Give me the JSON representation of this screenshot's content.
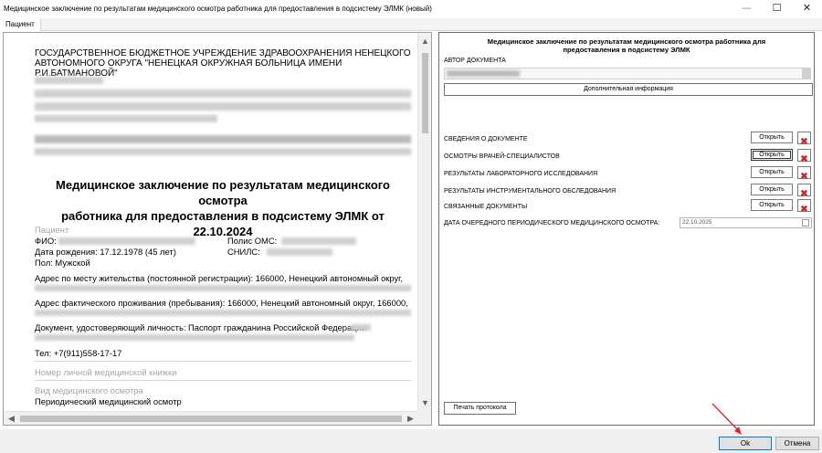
{
  "window": {
    "title": "Медицинское заключение по результатам медицинского осмотра работника для предоставления в подсистему ЭЛМК (новый)",
    "minimize_icon": "—",
    "maximize_icon": "☐",
    "close_icon": "✕"
  },
  "tab": {
    "label": "Пациент"
  },
  "document": {
    "org_line1": "ГОСУДАРСТВЕННОЕ БЮДЖЕТНОЕ УЧРЕЖДЕНИЕ ЗДРАВООХРАНЕНИЯ НЕНЕЦКОГО",
    "org_line2": "АВТОНОМНОГО ОКРУГА \"НЕНЕЦКАЯ ОКРУЖНАЯ БОЛЬНИЦА ИМЕНИ Р.И.БАТМАНОВОЙ\"",
    "title_line1": "Медицинское заключение по результатам медицинского осмотра",
    "title_line2": "работника для предоставления в подсистему ЭЛМК от 22.10.2024",
    "patient_heading": "Пациент",
    "fio_label": "ФИО:",
    "polis_label": "Полис ОМС:",
    "birth": "Дата рождения: 17.12.1978 (45 лет)",
    "snils_label": "СНИЛС:",
    "sex": "Пол: Мужской",
    "address_reg": "Адрес по месту жительства (постоянной регистрации): 166000, Ненецкий автономный округ,",
    "address_fact": "Адрес фактического проживания (пребывания): 166000, Ненецкий автономный округ, 166000,",
    "id_doc": "Документ, удостоверяющий личность: Паспорт гражданина Российской Федерации",
    "phone": "Тел: +7(911)558-17-17",
    "medbook_heading": "Номер личной медицинской книжки",
    "exam_type_heading": "Вид медицинского осмотра",
    "exam_type": "Периодический медицинский осмотр"
  },
  "right_panel": {
    "title_line1": "Медицинское заключение по результатам медицинского осмотра работника для",
    "title_line2": "предоставления в подсистему ЭЛМК",
    "author_label": "АВТОР ДОКУМЕНТА",
    "additional_info_button": "Дополнительная информация",
    "sections": [
      {
        "label": "СВЕДЕНИЯ О ДОКУМЕНТЕ",
        "open": "Открыть"
      },
      {
        "label": "ОСМОТРЫ ВРАЧЕЙ-СПЕЦИАЛИСТОВ",
        "open": "Открыть"
      },
      {
        "label": "РЕЗУЛЬТАТЫ ЛАБОРАТОРНОГО ИССЛЕДОВАНИЯ",
        "open": "Открыть"
      },
      {
        "label": "РЕЗУЛЬТАТЫ ИНСТРУМЕНТАЛЬНОГО ОБСЛЕДОВАНИЯ",
        "open": "Открыть"
      },
      {
        "label": "СВЯЗАННЫЕ ДОКУМЕНТЫ",
        "open": "Открыть"
      }
    ],
    "next_exam_label": "ДАТА ОЧЕРЕДНОГО ПЕРИОДИЧЕСКОГО МЕДИЦИНСКОГО ОСМОТРА:",
    "next_exam_date": "22.10.2025",
    "print_button": "Печать протокола"
  },
  "footer": {
    "ok": "Ok",
    "cancel": "Отмена"
  },
  "colors": {
    "delete_red": "#c8262b",
    "focus_blue": "#0078d7",
    "annotation_arrow": "#e0282c"
  },
  "icons": {
    "delete": "delete-x-icon",
    "calendar": "calendar-icon",
    "scroll_up": "▲",
    "scroll_down": "▼",
    "scroll_left": "◀",
    "scroll_right": "▶"
  }
}
